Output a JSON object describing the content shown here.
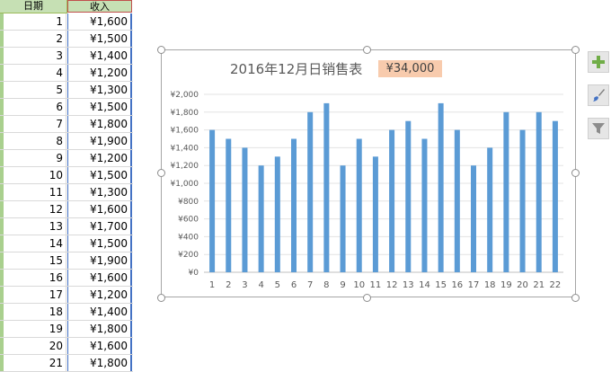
{
  "sheet": {
    "col_a_header": "日期",
    "col_b_header": "收入",
    "rows": [
      {
        "day": "1",
        "income": "¥1,600"
      },
      {
        "day": "2",
        "income": "¥1,500"
      },
      {
        "day": "3",
        "income": "¥1,400"
      },
      {
        "day": "4",
        "income": "¥1,200"
      },
      {
        "day": "5",
        "income": "¥1,300"
      },
      {
        "day": "6",
        "income": "¥1,500"
      },
      {
        "day": "7",
        "income": "¥1,800"
      },
      {
        "day": "8",
        "income": "¥1,900"
      },
      {
        "day": "9",
        "income": "¥1,200"
      },
      {
        "day": "10",
        "income": "¥1,500"
      },
      {
        "day": "11",
        "income": "¥1,300"
      },
      {
        "day": "12",
        "income": "¥1,600"
      },
      {
        "day": "13",
        "income": "¥1,700"
      },
      {
        "day": "14",
        "income": "¥1,500"
      },
      {
        "day": "15",
        "income": "¥1,900"
      },
      {
        "day": "16",
        "income": "¥1,600"
      },
      {
        "day": "17",
        "income": "¥1,200"
      },
      {
        "day": "18",
        "income": "¥1,400"
      },
      {
        "day": "19",
        "income": "¥1,800"
      },
      {
        "day": "20",
        "income": "¥1,600"
      },
      {
        "day": "21",
        "income": "¥1,800"
      }
    ]
  },
  "chart": {
    "title": "2016年12月日销售表",
    "total": "¥34,000"
  },
  "chart_data": {
    "type": "bar",
    "title": "2016年12月日销售表",
    "categories": [
      "1",
      "2",
      "3",
      "4",
      "5",
      "6",
      "7",
      "8",
      "9",
      "10",
      "11",
      "12",
      "13",
      "14",
      "15",
      "16",
      "17",
      "18",
      "19",
      "20",
      "21",
      "22"
    ],
    "values": [
      1600,
      1500,
      1400,
      1200,
      1300,
      1500,
      1800,
      1900,
      1200,
      1500,
      1300,
      1600,
      1700,
      1500,
      1900,
      1600,
      1200,
      1400,
      1800,
      1600,
      1800,
      1700
    ],
    "ylim": [
      0,
      2000
    ],
    "yticks": [
      "¥0",
      "¥200",
      "¥400",
      "¥600",
      "¥800",
      "¥1,000",
      "¥1,200",
      "¥1,400",
      "¥1,600",
      "¥1,800",
      "¥2,000"
    ],
    "grid": true,
    "bar_color": "#5b9bd5",
    "xlabel": "",
    "ylabel": ""
  },
  "tools": [
    {
      "icon": "plus-icon"
    },
    {
      "icon": "brush-icon"
    },
    {
      "icon": "filter-icon"
    }
  ],
  "colors": {
    "header_fill": "#c6e0b4",
    "total_fill": "#f8cbad",
    "series": "#5b9bd5"
  }
}
